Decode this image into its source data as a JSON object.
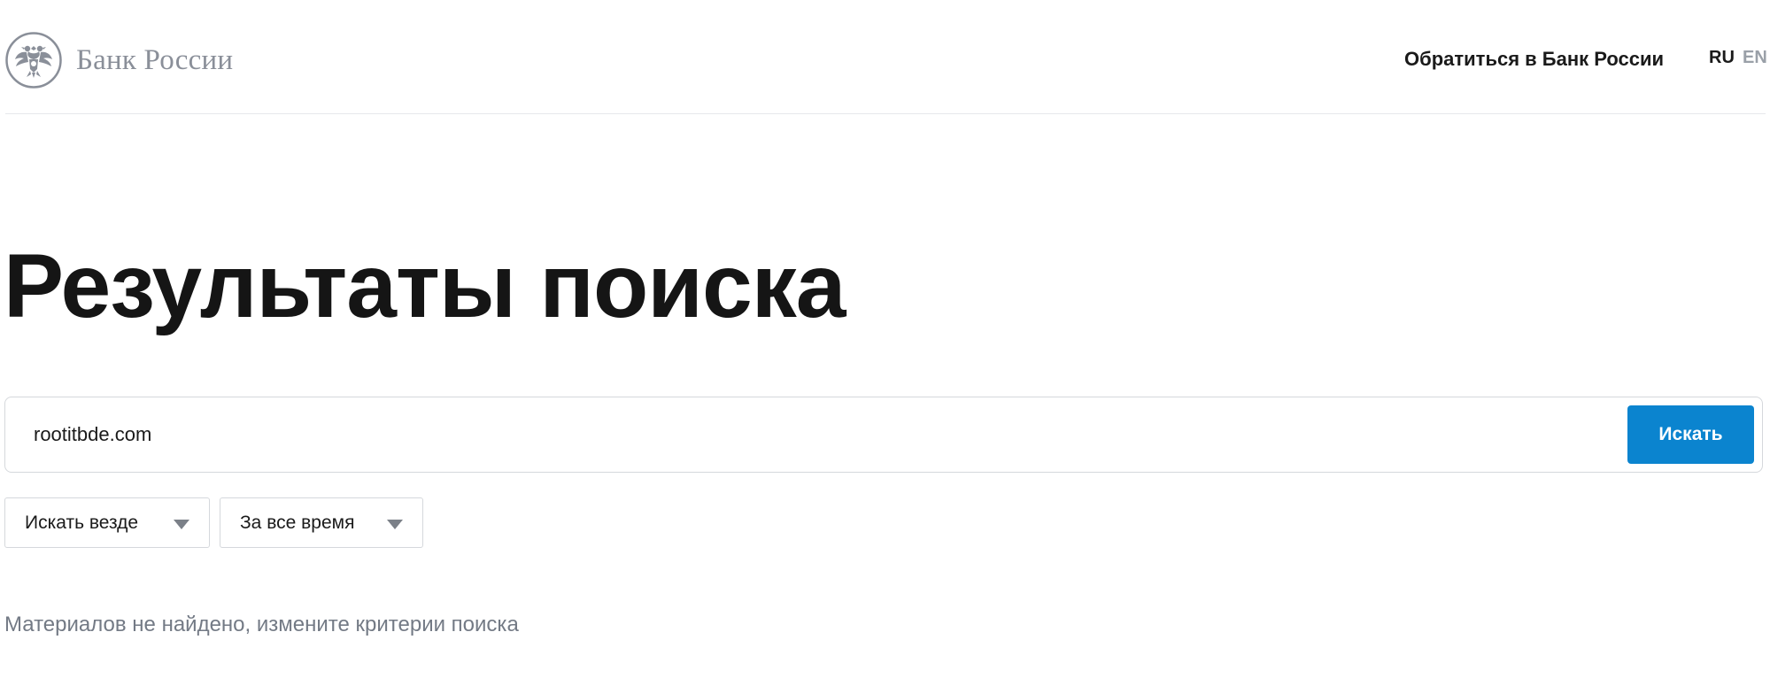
{
  "header": {
    "logo_text": "Банк России",
    "contact_link": "Обратиться в Банк России",
    "languages": [
      {
        "code": "RU",
        "active": true
      },
      {
        "code": "EN",
        "active": false
      }
    ]
  },
  "main": {
    "title": "Результаты поиска",
    "search": {
      "value": "rootitbde.com",
      "button_label": "Искать"
    },
    "filters": {
      "where": "Искать везде",
      "period": "За все время"
    },
    "empty_message": "Материалов не найдено, измените критерии поиска"
  },
  "colors": {
    "accent": "#0b84cf",
    "muted_text": "#737a85",
    "logo_text": "#8a8f99"
  },
  "icons": {
    "logo": "double-headed-eagle-emblem",
    "filter_chevron": "chevron-down-icon"
  }
}
